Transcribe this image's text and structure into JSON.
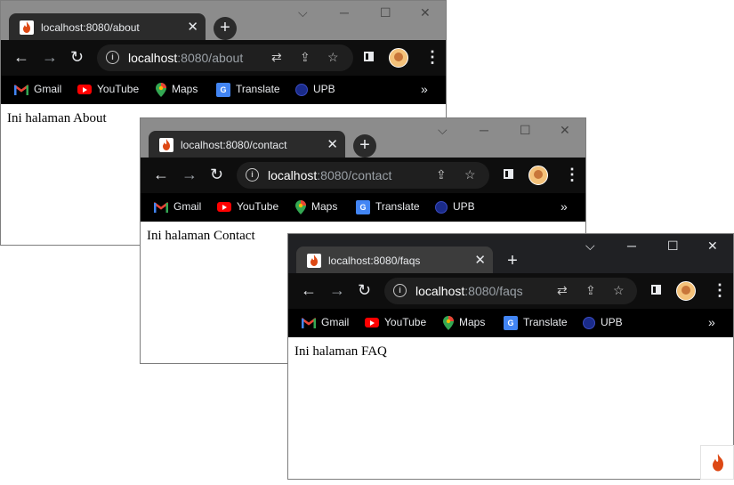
{
  "bookmarks": [
    "Gmail",
    "YouTube",
    "Maps",
    "Translate",
    "UPB"
  ],
  "windows": [
    {
      "tab_title": "localhost:8080/about",
      "url_host": "localhost",
      "url_path": ":8080/about",
      "page_text": "Ini halaman About"
    },
    {
      "tab_title": "localhost:8080/contact",
      "url_host": "localhost",
      "url_path": ":8080/contact",
      "page_text": "Ini halaman Contact"
    },
    {
      "tab_title": "localhost:8080/faqs",
      "url_host": "localhost",
      "url_path": ":8080/faqs",
      "page_text": "Ini halaman FAQ"
    }
  ],
  "icons": {
    "tab_favicon": "codeigniter-flame-icon",
    "close": "close-icon",
    "new_tab": "plus-icon",
    "back": "back-arrow-icon",
    "forward": "forward-arrow-icon",
    "reload": "reload-icon",
    "site_info": "info-icon",
    "translate_page": "translate-icon",
    "share": "share-icon",
    "bookmark_star": "star-icon",
    "side_panel": "side-panel-icon",
    "profile": "avatar",
    "menu": "kebab-menu-icon",
    "more_bookmarks": "chevron-double-right-icon"
  },
  "colors": {
    "titlebar": "#8c8c8c",
    "toolbar": "#0e0e0e",
    "tab": "#2b2b2b",
    "flame": "#dd4814"
  }
}
